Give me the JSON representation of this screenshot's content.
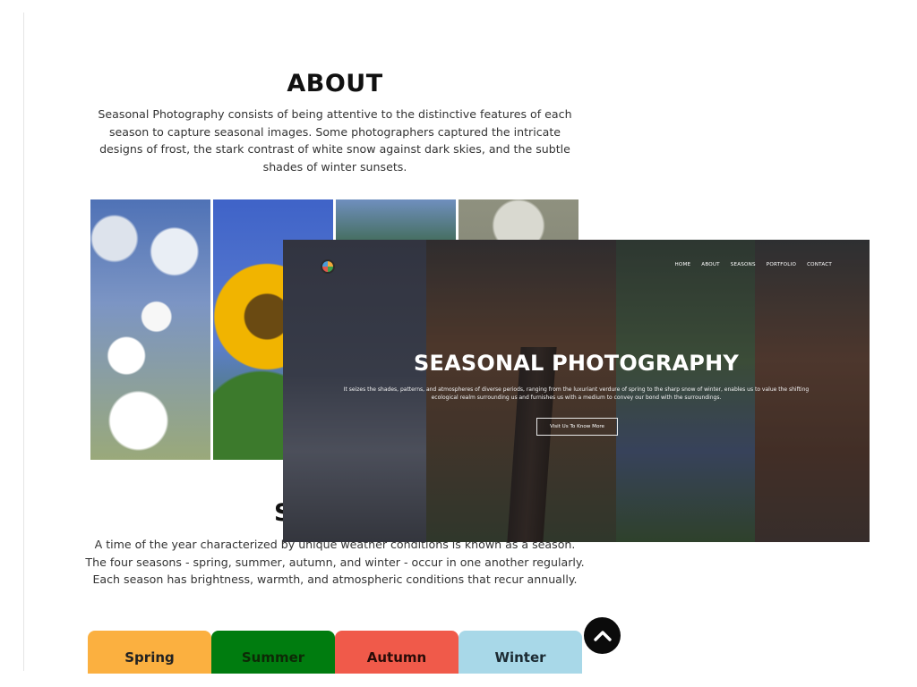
{
  "about": {
    "title": "ABOUT",
    "text": "Seasonal Photography consists of being attentive to the distinctive features of each season to capture seasonal images. Some photographers captured the intricate designs of frost, the stark contrast of white snow against dark skies, and the subtle shades of winter sunsets."
  },
  "seasons_section": {
    "title_peek": "S",
    "text": "A time of the year characterized by unique weather conditions is known as a season. The four seasons - spring, summer, autumn, and winter - occur in one another regularly. Each season has brightness, warmth, and atmospheric conditions that recur annually."
  },
  "tabs": [
    {
      "label": "Spring",
      "color": "#fbb040"
    },
    {
      "label": "Summer",
      "color": "#007c0f"
    },
    {
      "label": "Autumn",
      "color": "#f05a4a"
    },
    {
      "label": "Winter",
      "color": "#a8d8e8"
    }
  ],
  "hero": {
    "nav": [
      "HOME",
      "ABOUT",
      "SEASONS",
      "PORTFOLIO",
      "CONTACT"
    ],
    "title": "SEASONAL PHOTOGRAPHY",
    "subtitle": "It seizes the shades, patterns, and atmospheres of diverse periods, ranging from the luxuriant verdure of spring to the sharp snow of winter, enables us to value the shifting ecological realm surrounding us and furnishes us with a medium to convey our bond with the surroundings.",
    "button_label": "Visit Us To Know More"
  },
  "icons": {
    "back_to_top": "chevron-up-icon",
    "logo": "logo-icon"
  }
}
